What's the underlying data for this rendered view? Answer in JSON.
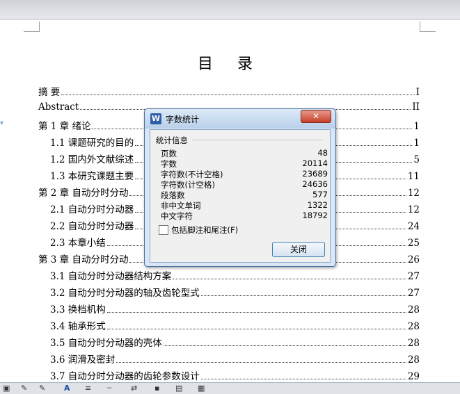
{
  "toc": {
    "title": "目 录",
    "entries": [
      {
        "text": "摘    要",
        "page": "I"
      },
      {
        "text": "Abstract",
        "page": "II"
      },
      {
        "text": "第 1 章  绪论",
        "page": "1"
      },
      {
        "text": "1.1  课题研究的目的",
        "page": "1"
      },
      {
        "text": "1.2  国内外文献综述",
        "page": "5"
      },
      {
        "text": "1.3  本研究课题主要",
        "page": "11"
      },
      {
        "text": "第 2 章  自动分时分动",
        "page": "12"
      },
      {
        "text": "2.1  自动分时分动器",
        "page": "12"
      },
      {
        "text": "2.2  自动分时分动器",
        "page": "24"
      },
      {
        "text": "2.3  本章小结",
        "page": "25"
      },
      {
        "text": "第 3 章  自动分时分动",
        "page": "26"
      },
      {
        "text": "3.1  自动分时分动器结构方案",
        "page": "27"
      },
      {
        "text": "3.2  自动分时分动器的轴及齿轮型式",
        "page": "27"
      },
      {
        "text": "3.3  换档机构",
        "page": "28"
      },
      {
        "text": "3.4  轴承形式",
        "page": "28"
      },
      {
        "text": "3.5  自动分时分动器的壳体",
        "page": "28"
      },
      {
        "text": "3.6  润滑及密封",
        "page": "28"
      },
      {
        "text": "3.7  自动分时分动器的齿轮参数设计",
        "page": "29"
      }
    ]
  },
  "dialog": {
    "title": "字数统计",
    "close_glyph": "✕",
    "group_label": "统计信息",
    "stats": [
      {
        "label": "页数",
        "value": "48"
      },
      {
        "label": "字数",
        "value": "20114"
      },
      {
        "label": "字符数(不计空格)",
        "value": "23689"
      },
      {
        "label": "字符数(计空格)",
        "value": "24636"
      },
      {
        "label": "段落数",
        "value": "577"
      },
      {
        "label": "非中文单词",
        "value": "1322"
      },
      {
        "label": "中文字符",
        "value": "18792"
      }
    ],
    "checkbox_label": "包括脚注和尾注(F)",
    "checkbox_checked": false,
    "button_label": "关闭"
  },
  "icons": {
    "app": "W",
    "statusbar": [
      "paint-bucket-icon",
      "pen-icon",
      "font-color-icon",
      "line-style-icon",
      "dash-style-icon",
      "arrow-style-icon",
      "shadow-icon",
      "3d-icon"
    ]
  }
}
